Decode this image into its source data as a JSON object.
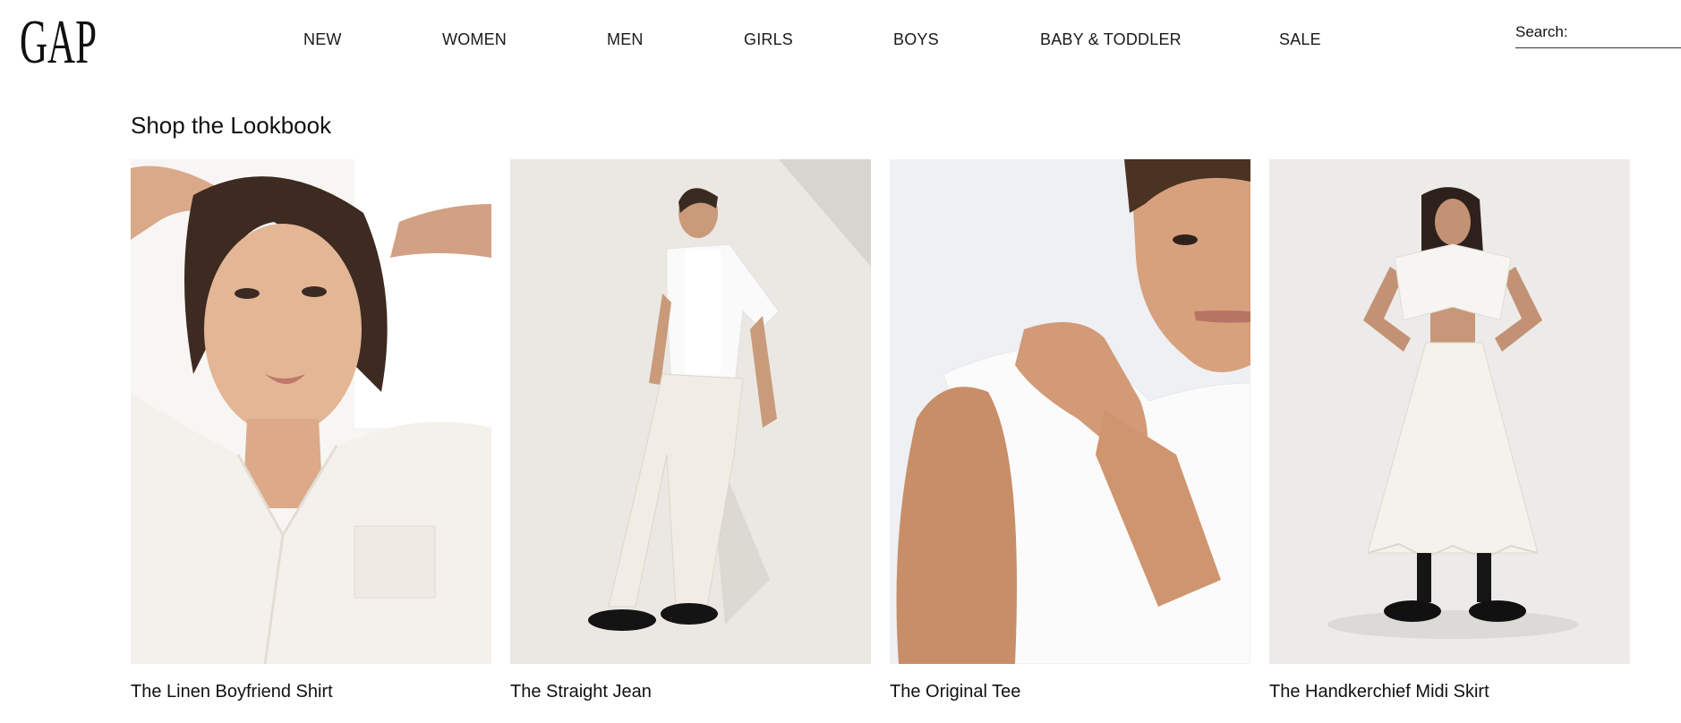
{
  "brand": {
    "logo_text": "GAP"
  },
  "nav": {
    "items": [
      {
        "label": "NEW"
      },
      {
        "label": "WOMEN"
      },
      {
        "label": "MEN"
      },
      {
        "label": "GIRLS"
      },
      {
        "label": "BOYS"
      },
      {
        "label": "BABY & TODDLER"
      },
      {
        "label": "SALE"
      }
    ]
  },
  "search": {
    "label": "Search:",
    "value": "",
    "placeholder": ""
  },
  "lookbook": {
    "title": "Shop the Lookbook",
    "cards": [
      {
        "caption": "The Linen Boyfriend Shirt"
      },
      {
        "caption": "The Straight Jean"
      },
      {
        "caption": "The Original Tee"
      },
      {
        "caption": "The Handkerchief Midi Skirt"
      }
    ]
  },
  "colors": {
    "text": "#111111",
    "background": "#ffffff",
    "photo_background": "#f1efec"
  }
}
